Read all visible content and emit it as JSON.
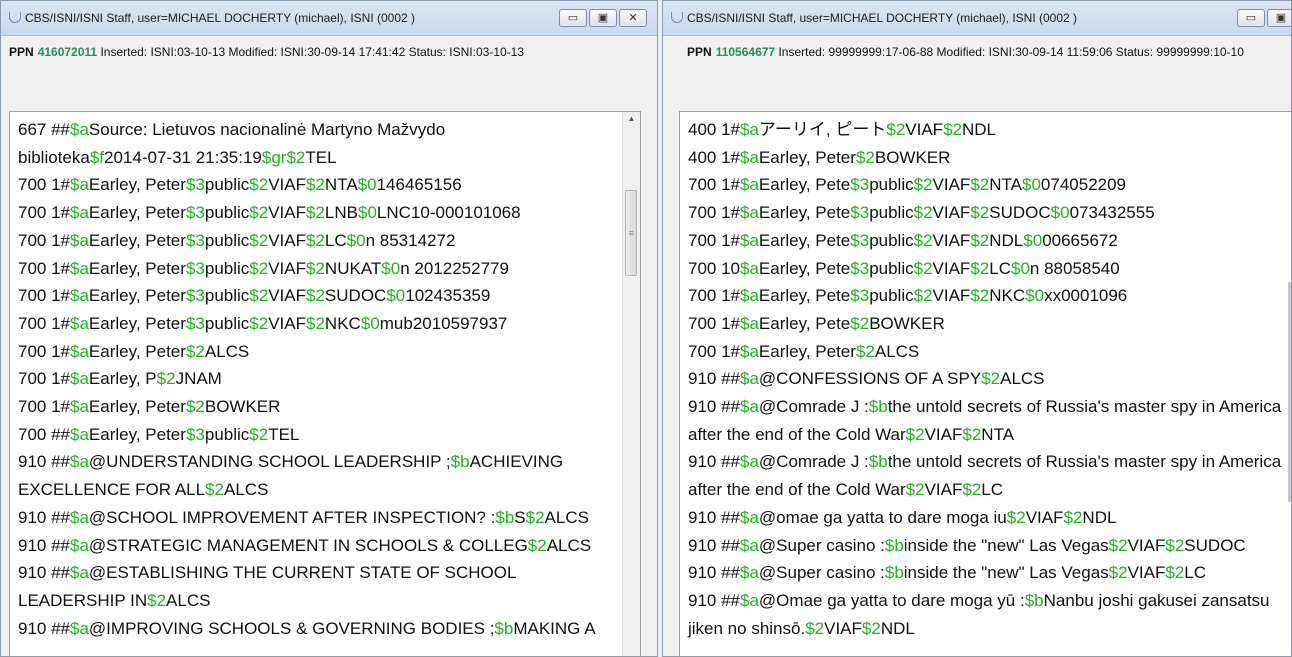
{
  "left_window": {
    "title": "CBS/ISNI/ISNI Staff, user=MICHAEL DOCHERTY (michael), ISNI (0002 )",
    "ppn_label": "PPN",
    "ppn_number": "416072011",
    "ppn_rest": "Inserted: ISNI:03-10-13 Modified: ISNI:30-09-14 17:41:42 Status: ISNI:03-10-13",
    "controls": {
      "minimize": "▭",
      "maximize": "▣",
      "close": "✕"
    },
    "lines": [
      [
        [
          "t",
          "667 ##"
        ],
        [
          "s",
          "$a"
        ],
        [
          "t",
          "Source: Lietuvos nacionalinė Martyno Mažvydo"
        ]
      ],
      [
        [
          "t",
          " biblioteka"
        ],
        [
          "s",
          "$f"
        ],
        [
          "t",
          "2014-07-31 21:35:19"
        ],
        [
          "s",
          "$gr$2"
        ],
        [
          "t",
          "TEL"
        ]
      ],
      [
        [
          "t",
          "700 1#"
        ],
        [
          "s",
          "$a"
        ],
        [
          "t",
          "Earley, Peter"
        ],
        [
          "s",
          "$3"
        ],
        [
          "t",
          "public"
        ],
        [
          "s",
          "$2"
        ],
        [
          "t",
          "VIAF"
        ],
        [
          "s",
          "$2"
        ],
        [
          "t",
          "NTA"
        ],
        [
          "s",
          "$0"
        ],
        [
          "t",
          "146465156"
        ]
      ],
      [
        [
          "t",
          "700 1#"
        ],
        [
          "s",
          "$a"
        ],
        [
          "t",
          "Earley, Peter"
        ],
        [
          "s",
          "$3"
        ],
        [
          "t",
          "public"
        ],
        [
          "s",
          "$2"
        ],
        [
          "t",
          "VIAF"
        ],
        [
          "s",
          "$2"
        ],
        [
          "t",
          "LNB"
        ],
        [
          "s",
          "$0"
        ],
        [
          "t",
          "LNC10-000101068"
        ]
      ],
      [
        [
          "t",
          "700 1#"
        ],
        [
          "s",
          "$a"
        ],
        [
          "t",
          "Earley, Peter"
        ],
        [
          "s",
          "$3"
        ],
        [
          "t",
          "public"
        ],
        [
          "s",
          "$2"
        ],
        [
          "t",
          "VIAF"
        ],
        [
          "s",
          "$2"
        ],
        [
          "t",
          "LC"
        ],
        [
          "s",
          "$0"
        ],
        [
          "t",
          "n  85314272"
        ]
      ],
      [
        [
          "t",
          "700 1#"
        ],
        [
          "s",
          "$a"
        ],
        [
          "t",
          "Earley, Peter"
        ],
        [
          "s",
          "$3"
        ],
        [
          "t",
          "public"
        ],
        [
          "s",
          "$2"
        ],
        [
          "t",
          "VIAF"
        ],
        [
          "s",
          "$2"
        ],
        [
          "t",
          "NUKAT"
        ],
        [
          "s",
          "$0"
        ],
        [
          "t",
          "n 2012252779"
        ]
      ],
      [
        [
          "t",
          "700 1#"
        ],
        [
          "s",
          "$a"
        ],
        [
          "t",
          "Earley, Peter"
        ],
        [
          "s",
          "$3"
        ],
        [
          "t",
          "public"
        ],
        [
          "s",
          "$2"
        ],
        [
          "t",
          "VIAF"
        ],
        [
          "s",
          "$2"
        ],
        [
          "t",
          "SUDOC"
        ],
        [
          "s",
          "$0"
        ],
        [
          "t",
          "102435359"
        ]
      ],
      [
        [
          "t",
          "700 1#"
        ],
        [
          "s",
          "$a"
        ],
        [
          "t",
          "Earley, Peter"
        ],
        [
          "s",
          "$3"
        ],
        [
          "t",
          "public"
        ],
        [
          "s",
          "$2"
        ],
        [
          "t",
          "VIAF"
        ],
        [
          "s",
          "$2"
        ],
        [
          "t",
          "NKC"
        ],
        [
          "s",
          "$0"
        ],
        [
          "t",
          "mub2010597937"
        ]
      ],
      [
        [
          "t",
          "700 1#"
        ],
        [
          "s",
          "$a"
        ],
        [
          "t",
          "Earley, Peter"
        ],
        [
          "s",
          "$2"
        ],
        [
          "t",
          "ALCS"
        ]
      ],
      [
        [
          "t",
          "700 1#"
        ],
        [
          "s",
          "$a"
        ],
        [
          "t",
          "Earley, P"
        ],
        [
          "s",
          "$2"
        ],
        [
          "t",
          "JNAM"
        ]
      ],
      [
        [
          "t",
          "700 1#"
        ],
        [
          "s",
          "$a"
        ],
        [
          "t",
          "Earley, Peter"
        ],
        [
          "s",
          "$2"
        ],
        [
          "t",
          "BOWKER"
        ]
      ],
      [
        [
          "t",
          "700 ##"
        ],
        [
          "s",
          "$a"
        ],
        [
          "t",
          "Earley, Peter"
        ],
        [
          "s",
          "$3"
        ],
        [
          "t",
          "public"
        ],
        [
          "s",
          "$2"
        ],
        [
          "t",
          "TEL"
        ]
      ],
      [
        [
          "t",
          "910 ##"
        ],
        [
          "s",
          "$a"
        ],
        [
          "t",
          "@UNDERSTANDING SCHOOL LEADERSHIP ;"
        ],
        [
          "s",
          "$b"
        ],
        [
          "t",
          "ACHIEVING"
        ]
      ],
      [
        [
          "t",
          " EXCELLENCE FOR ALL"
        ],
        [
          "s",
          "$2"
        ],
        [
          "t",
          "ALCS"
        ]
      ],
      [
        [
          "t",
          "910 ##"
        ],
        [
          "s",
          "$a"
        ],
        [
          "t",
          "@SCHOOL IMPROVEMENT AFTER INSPECTION? :"
        ],
        [
          "s",
          "$b"
        ],
        [
          "t",
          "S"
        ],
        [
          "s",
          "$2"
        ],
        [
          "t",
          "ALCS"
        ]
      ],
      [
        [
          "t",
          "910 ##"
        ],
        [
          "s",
          "$a"
        ],
        [
          "t",
          "@STRATEGIC MANAGEMENT IN SCHOOLS & COLLEG"
        ],
        [
          "s",
          "$2"
        ],
        [
          "t",
          "ALCS"
        ]
      ],
      [
        [
          "t",
          "910 ##"
        ],
        [
          "s",
          "$a"
        ],
        [
          "t",
          "@ESTABLISHING THE CURRENT STATE OF SCHOOL"
        ]
      ],
      [
        [
          "t",
          " LEADERSHIP IN"
        ],
        [
          "s",
          "$2"
        ],
        [
          "t",
          "ALCS"
        ]
      ],
      [
        [
          "t",
          "910 ##"
        ],
        [
          "s",
          "$a"
        ],
        [
          "t",
          "@IMPROVING SCHOOLS & GOVERNING BODIES ;"
        ],
        [
          "s",
          "$b"
        ],
        [
          "t",
          "MAKING A"
        ]
      ]
    ]
  },
  "right_window": {
    "title": "CBS/ISNI/ISNI Staff, user=MICHAEL DOCHERTY (michael), ISNI (0002 )",
    "ppn_label": "PPN",
    "ppn_number": "110564677",
    "ppn_rest": "Inserted: 99999999:17-06-88 Modified: ISNI:30-09-14 11:59:06 Status: 99999999:10-10",
    "controls": {
      "minimize": "▭",
      "maximize": "▣"
    },
    "lines": [
      [
        [
          "t",
          "400 1#"
        ],
        [
          "s",
          "$a"
        ],
        [
          "t",
          "アーリイ, ピート"
        ],
        [
          "s",
          "$2"
        ],
        [
          "t",
          "VIAF"
        ],
        [
          "s",
          "$2"
        ],
        [
          "t",
          "NDL"
        ]
      ],
      [
        [
          "t",
          "400 1#"
        ],
        [
          "s",
          "$a"
        ],
        [
          "t",
          "Earley, Peter"
        ],
        [
          "s",
          "$2"
        ],
        [
          "t",
          "BOWKER"
        ]
      ],
      [
        [
          "t",
          "700 1#"
        ],
        [
          "s",
          "$a"
        ],
        [
          "t",
          "Earley, Pete"
        ],
        [
          "s",
          "$3"
        ],
        [
          "t",
          "public"
        ],
        [
          "s",
          "$2"
        ],
        [
          "t",
          "VIAF"
        ],
        [
          "s",
          "$2"
        ],
        [
          "t",
          "NTA"
        ],
        [
          "s",
          "$0"
        ],
        [
          "t",
          "074052209"
        ]
      ],
      [
        [
          "t",
          "700 1#"
        ],
        [
          "s",
          "$a"
        ],
        [
          "t",
          "Earley, Pete"
        ],
        [
          "s",
          "$3"
        ],
        [
          "t",
          "public"
        ],
        [
          "s",
          "$2"
        ],
        [
          "t",
          "VIAF"
        ],
        [
          "s",
          "$2"
        ],
        [
          "t",
          "SUDOC"
        ],
        [
          "s",
          "$0"
        ],
        [
          "t",
          "073432555"
        ]
      ],
      [
        [
          "t",
          "700 1#"
        ],
        [
          "s",
          "$a"
        ],
        [
          "t",
          "Earley, Pete"
        ],
        [
          "s",
          "$3"
        ],
        [
          "t",
          "public"
        ],
        [
          "s",
          "$2"
        ],
        [
          "t",
          "VIAF"
        ],
        [
          "s",
          "$2"
        ],
        [
          "t",
          "NDL"
        ],
        [
          "s",
          "$0"
        ],
        [
          "t",
          "00665672"
        ]
      ],
      [
        [
          "t",
          "700 10"
        ],
        [
          "s",
          "$a"
        ],
        [
          "t",
          "Earley, Pete"
        ],
        [
          "s",
          "$3"
        ],
        [
          "t",
          "public"
        ],
        [
          "s",
          "$2"
        ],
        [
          "t",
          "VIAF"
        ],
        [
          "s",
          "$2"
        ],
        [
          "t",
          "LC"
        ],
        [
          "s",
          "$0"
        ],
        [
          "t",
          "n  88058540"
        ]
      ],
      [
        [
          "t",
          "700 1#"
        ],
        [
          "s",
          "$a"
        ],
        [
          "t",
          "Earley, Pete"
        ],
        [
          "s",
          "$3"
        ],
        [
          "t",
          "public"
        ],
        [
          "s",
          "$2"
        ],
        [
          "t",
          "VIAF"
        ],
        [
          "s",
          "$2"
        ],
        [
          "t",
          "NKC"
        ],
        [
          "s",
          "$0"
        ],
        [
          "t",
          "xx0001096"
        ]
      ],
      [
        [
          "t",
          "700 1#"
        ],
        [
          "s",
          "$a"
        ],
        [
          "t",
          "Earley, Pete"
        ],
        [
          "s",
          "$2"
        ],
        [
          "t",
          "BOWKER"
        ]
      ],
      [
        [
          "t",
          "700 1#"
        ],
        [
          "s",
          "$a"
        ],
        [
          "t",
          "Earley, Peter"
        ],
        [
          "s",
          "$2"
        ],
        [
          "t",
          "ALCS"
        ]
      ],
      [
        [
          "t",
          "910 ##"
        ],
        [
          "s",
          "$a"
        ],
        [
          "t",
          "@CONFESSIONS OF A SPY"
        ],
        [
          "s",
          "$2"
        ],
        [
          "t",
          "ALCS"
        ]
      ],
      [
        [
          "t",
          "910 ##"
        ],
        [
          "s",
          "$a"
        ],
        [
          "t",
          "@Comrade J :"
        ],
        [
          "s",
          "$b"
        ],
        [
          "t",
          "the untold secrets of Russia's master spy in America"
        ]
      ],
      [
        [
          "t",
          " after the end of the Cold War"
        ],
        [
          "s",
          "$2"
        ],
        [
          "t",
          "VIAF"
        ],
        [
          "s",
          "$2"
        ],
        [
          "t",
          "NTA"
        ]
      ],
      [
        [
          "t",
          "910 ##"
        ],
        [
          "s",
          "$a"
        ],
        [
          "t",
          "@Comrade J :"
        ],
        [
          "s",
          "$b"
        ],
        [
          "t",
          "the untold secrets of Russia's master spy in America"
        ]
      ],
      [
        [
          "t",
          " after the end of the Cold War"
        ],
        [
          "s",
          "$2"
        ],
        [
          "t",
          "VIAF"
        ],
        [
          "s",
          "$2"
        ],
        [
          "t",
          "LC"
        ]
      ],
      [
        [
          "t",
          "910 ##"
        ],
        [
          "s",
          "$a"
        ],
        [
          "t",
          "@omae ga yatta to dare moga iu"
        ],
        [
          "s",
          "$2"
        ],
        [
          "t",
          "VIAF"
        ],
        [
          "s",
          "$2"
        ],
        [
          "t",
          "NDL"
        ]
      ],
      [
        [
          "t",
          "910 ##"
        ],
        [
          "s",
          "$a"
        ],
        [
          "t",
          "@Super casino :"
        ],
        [
          "s",
          "$b"
        ],
        [
          "t",
          "inside the \"new\" Las Vegas"
        ],
        [
          "s",
          "$2"
        ],
        [
          "t",
          "VIAF"
        ],
        [
          "s",
          "$2"
        ],
        [
          "t",
          "SUDOC"
        ]
      ],
      [
        [
          "t",
          "910 ##"
        ],
        [
          "s",
          "$a"
        ],
        [
          "t",
          "@Super casino :"
        ],
        [
          "s",
          "$b"
        ],
        [
          "t",
          "inside the \"new\" Las Vegas"
        ],
        [
          "s",
          "$2"
        ],
        [
          "t",
          "VIAF"
        ],
        [
          "s",
          "$2"
        ],
        [
          "t",
          "LC"
        ]
      ],
      [
        [
          "t",
          "910 ##"
        ],
        [
          "s",
          "$a"
        ],
        [
          "t",
          "@Omae ga yatta to dare moga yū :"
        ],
        [
          "s",
          "$b"
        ],
        [
          "t",
          "Nanbu joshi gakusei zansatsu"
        ]
      ],
      [
        [
          "t",
          " jiken no shinsō."
        ],
        [
          "s",
          "$2"
        ],
        [
          "t",
          "VIAF"
        ],
        [
          "s",
          "$2"
        ],
        [
          "t",
          "NDL"
        ]
      ]
    ]
  },
  "colors": {
    "subfield": "#22b122",
    "ppn_number": "#2e8b57",
    "titlebar": "#c9d8ec"
  }
}
